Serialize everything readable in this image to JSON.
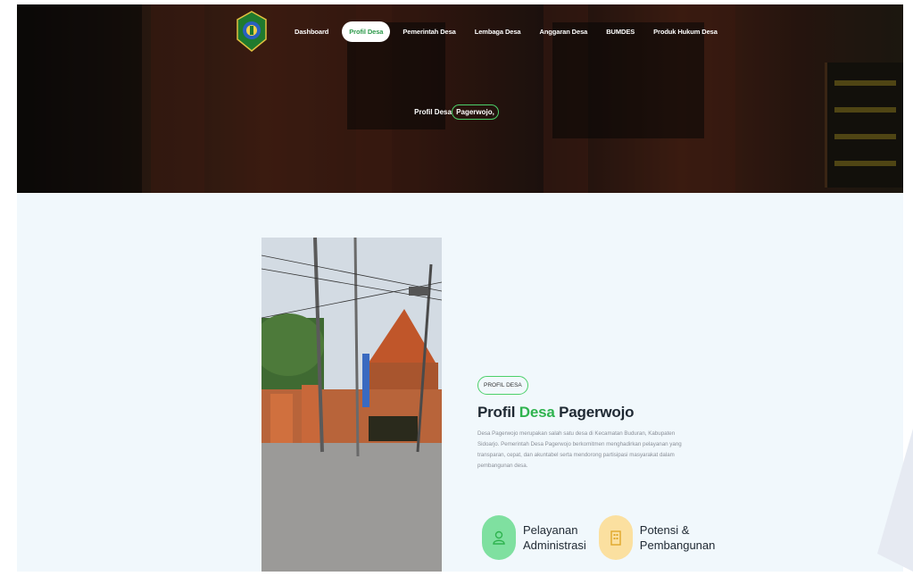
{
  "nav": {
    "items": [
      {
        "label": "Dashboard",
        "active": false
      },
      {
        "label": "Profil Desa",
        "active": true
      },
      {
        "label": "Pemerintah Desa",
        "active": false
      },
      {
        "label": "Lembaga Desa",
        "active": false
      },
      {
        "label": "Anggaran Desa",
        "active": false
      },
      {
        "label": "BUMDES",
        "active": false
      },
      {
        "label": "Produk Hukum Desa",
        "active": false
      }
    ]
  },
  "hero": {
    "title_prefix": "Profil Desa",
    "title_highlight": "Pagerwojo,"
  },
  "about": {
    "tag_prefix": "PROFIL",
    "tag_highlight": "DESA",
    "title_start": "Profil",
    "title_green": "Desa",
    "title_end": "Pagerwojo",
    "description": "Desa Pagerwojo merupakan salah satu desa di Kecamatan Buduran, Kabupaten Sidoarjo. Pemerintah Desa Pagerwojo berkomitmen menghadirkan pelayanan yang transparan, cepat, dan akuntabel serta mendorong partisipasi masyarakat dalam pembangunan desa."
  },
  "features": [
    {
      "line1": "Pelayanan",
      "line2": "Administrasi",
      "icon": "user-service-icon"
    },
    {
      "line1": "Potensi &",
      "line2": "Pembangunan",
      "icon": "building-icon"
    }
  ],
  "colors": {
    "accent_green": "#2fb34f",
    "ring_green": "#4cd06a",
    "feature_green": "#7fe0a0",
    "feature_yellow": "#fbe0a0"
  }
}
